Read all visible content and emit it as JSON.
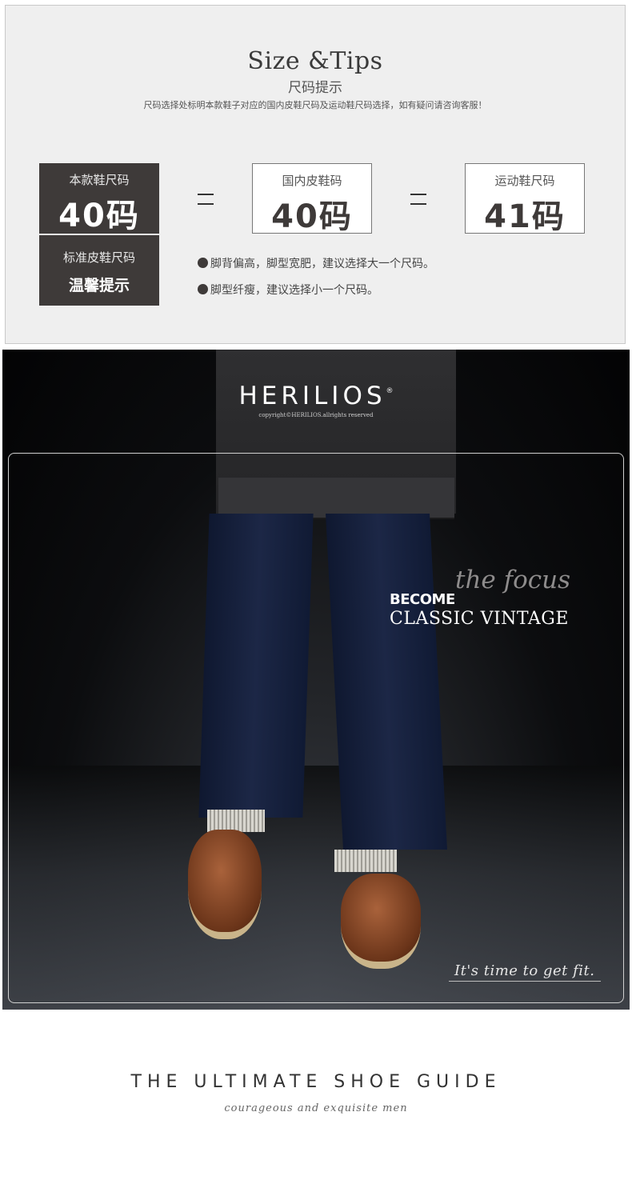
{
  "size_tips": {
    "title": "Size &Tips",
    "subtitle": "尺码提示",
    "description": "尺码选择处标明本款鞋子对应的国内皮鞋尺码及运动鞋尺码选择，如有疑问请咨询客服！",
    "this_style": {
      "label": "本款鞋尺码",
      "value": "40码"
    },
    "domestic_leather": {
      "label": "国内皮鞋码",
      "value": "40码"
    },
    "sports": {
      "label": "运动鞋尺码",
      "value": "41码"
    },
    "standard": {
      "label": "标准皮鞋尺码",
      "note": "温馨提示"
    },
    "tips": [
      "脚背偏高，脚型宽肥，建议选择大一个尺码。",
      "脚型纤瘦，建议选择小一个尺码。"
    ]
  },
  "banner": {
    "brand": "HERILIOS",
    "registered": "®",
    "copyright": "copyright©HERILIOS.allrights reserved",
    "focus": "the focus",
    "become": "BECOME",
    "classic": "CLASSIC VINTAGE",
    "script": "It's time to get fit."
  },
  "footer": {
    "title": "THE ULTIMATE SHOE GUIDE",
    "subtitle": "courageous and exquisite men"
  }
}
